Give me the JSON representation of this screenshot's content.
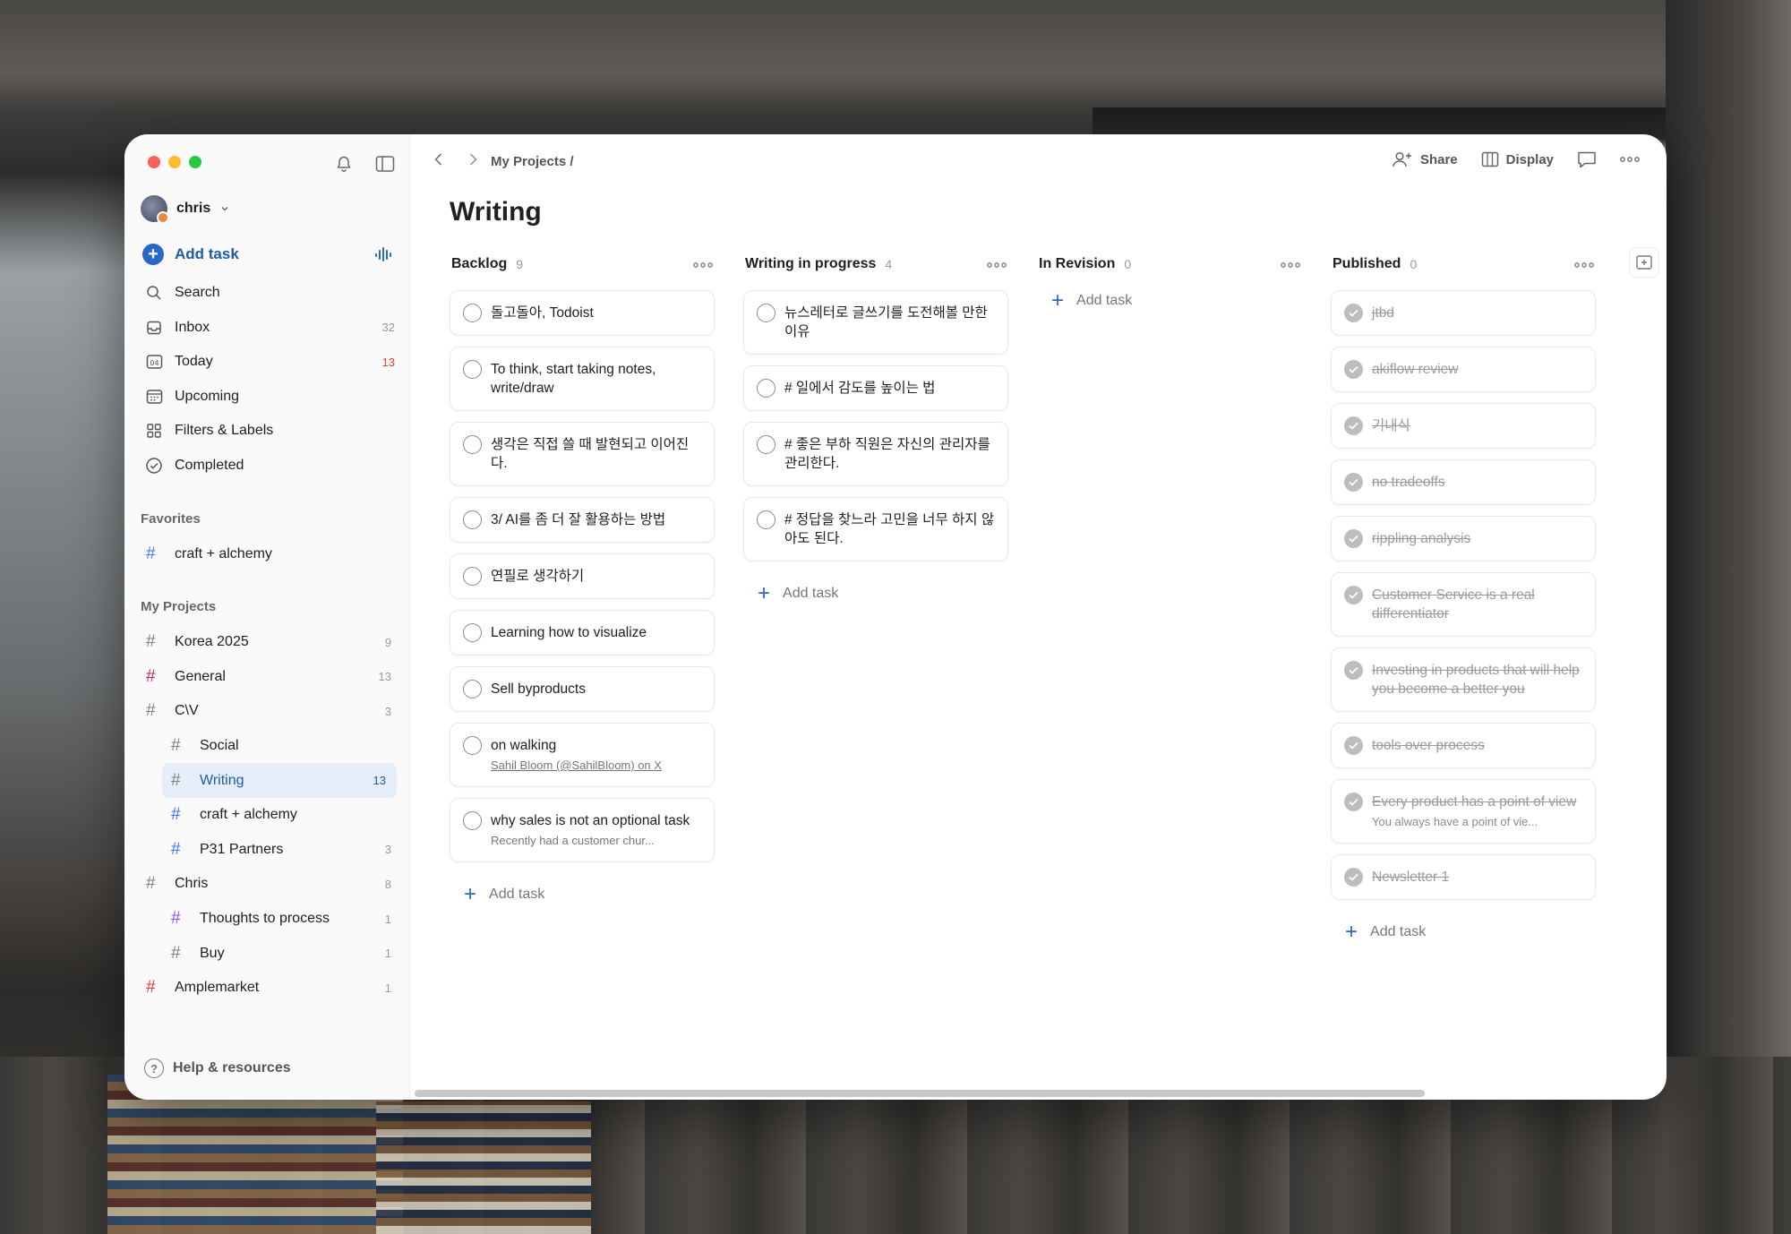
{
  "window": {
    "user": "chris",
    "add_task": "Add task",
    "nav": [
      {
        "label": "Search",
        "count": "",
        "icon": "search-icon"
      },
      {
        "label": "Inbox",
        "count": "32",
        "icon": "inbox-icon"
      },
      {
        "label": "Today",
        "count": "13",
        "icon": "calendar-today-icon",
        "count_color": "red"
      },
      {
        "label": "Upcoming",
        "count": "",
        "icon": "calendar-icon"
      },
      {
        "label": "Filters & Labels",
        "count": "",
        "icon": "grid-icon"
      },
      {
        "label": "Completed",
        "count": "",
        "icon": "check-circle-icon"
      }
    ],
    "today_icon_text": "04",
    "favorites_title": "Favorites",
    "favorites": [
      {
        "label": "craft + alchemy",
        "count": "",
        "color": "#4073ff"
      }
    ],
    "projects_title": "My Projects",
    "projects": [
      {
        "label": "Korea 2025",
        "count": "9",
        "color": "#808080",
        "sub": false
      },
      {
        "label": "General",
        "count": "13",
        "color": "#b8256f",
        "sub": false
      },
      {
        "label": "C\\V",
        "count": "3",
        "color": "#808080",
        "sub": false
      },
      {
        "label": "Social",
        "count": "",
        "color": "#808080",
        "sub": true
      },
      {
        "label": "Writing",
        "count": "13",
        "color": "#808080",
        "sub": true,
        "active": true
      },
      {
        "label": "craft + alchemy",
        "count": "",
        "color": "#4073ff",
        "sub": true
      },
      {
        "label": "P31 Partners",
        "count": "3",
        "color": "#4073ff",
        "sub": true
      },
      {
        "label": "Chris",
        "count": "8",
        "color": "#808080",
        "sub": false
      },
      {
        "label": "Thoughts to process",
        "count": "1",
        "color": "#884dff",
        "sub": true
      },
      {
        "label": "Buy",
        "count": "1",
        "color": "#808080",
        "sub": true
      },
      {
        "label": "Amplemarket",
        "count": "1",
        "color": "#db4035",
        "sub": false
      }
    ],
    "help": "Help & resources"
  },
  "topbar": {
    "breadcrumb": "My Projects /",
    "share": "Share",
    "display": "Display"
  },
  "page_title": "Writing",
  "add_task_label": "Add task",
  "columns": [
    {
      "name": "Backlog",
      "count": "9",
      "tasks": [
        {
          "title": "돌고돌아, Todoist"
        },
        {
          "title": "To think, start taking notes, write/draw"
        },
        {
          "title": "생각은 직접 쓸 때 발현되고 이어진다."
        },
        {
          "title": "3/ AI를 좀 더 잘 활용하는 방법"
        },
        {
          "title": "연필로 생각하기"
        },
        {
          "title": "Learning how to visualize"
        },
        {
          "title": "Sell byproducts"
        },
        {
          "title": "on walking",
          "sub": "Sahil Bloom (@SahilBloom) on X",
          "sub_link": true
        },
        {
          "title": "why sales is not an optional task",
          "sub": "Recently had a customer chur..."
        }
      ]
    },
    {
      "name": "Writing in progress",
      "count": "4",
      "tasks": [
        {
          "title": "뉴스레터로 글쓰기를 도전해볼 만한 이유"
        },
        {
          "title": "# 일에서 감도를 높이는 법"
        },
        {
          "title": "# 좋은 부하 직원은 자신의 관리자를 관리한다."
        },
        {
          "title": "# 정답을 찾느라 고민을 너무 하지 않아도 된다."
        }
      ]
    },
    {
      "name": "In Revision",
      "count": "0",
      "tasks": []
    },
    {
      "name": "Published",
      "count": "0",
      "tasks": [
        {
          "title": "jtbd",
          "done": true
        },
        {
          "title": "akiflow review",
          "done": true
        },
        {
          "title": "기내식",
          "done": true
        },
        {
          "title": "no tradeoffs",
          "done": true
        },
        {
          "title": "rippling analysis",
          "done": true
        },
        {
          "title": "Customer Service is a real differentiator",
          "done": true
        },
        {
          "title": "Investing in products that will help you become a better you",
          "done": true
        },
        {
          "title": "tools over process",
          "done": true
        },
        {
          "title": "Every product has a point of view",
          "sub": "You always have a point of vie...",
          "done": true
        },
        {
          "title": "Newsletter 1",
          "done": true
        }
      ]
    }
  ]
}
